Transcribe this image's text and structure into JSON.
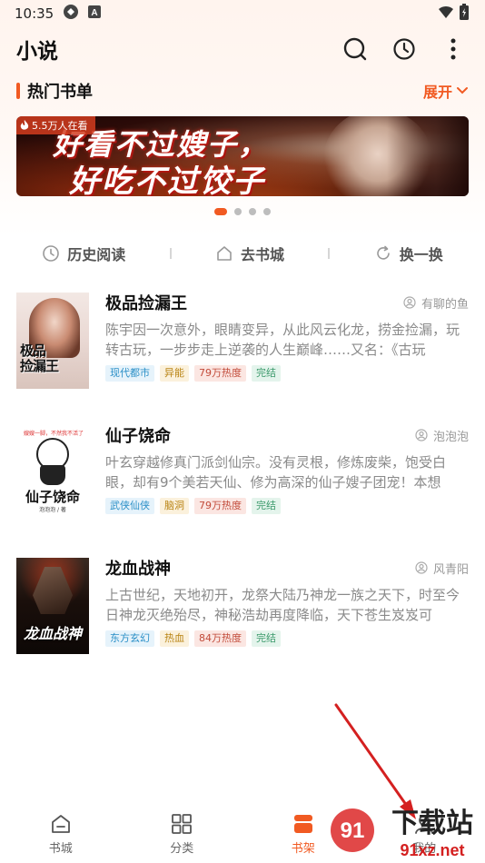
{
  "status_bar": {
    "time": "10:35"
  },
  "app_bar": {
    "title": "小说"
  },
  "section": {
    "title": "热门书单",
    "expand_label": "展开"
  },
  "banner": {
    "badge": "5.5万人在看",
    "line1": "好看不过嫂子，",
    "line2": "好吃不过饺子"
  },
  "carousel": {
    "pages": 4,
    "active": 0
  },
  "quick_actions": [
    {
      "label": "历史阅读",
      "icon": "clock-icon"
    },
    {
      "label": "去书城",
      "icon": "home-icon"
    },
    {
      "label": "换一换",
      "icon": "refresh-icon"
    }
  ],
  "books": [
    {
      "title": "极品捡漏王",
      "author": "有聊的鱼",
      "description": "陈宇因一次意外，眼睛变异，从此风云化龙，捞金捡漏，玩转古玩，一步步走上逆袭的人生巅峰……又名：《古玩",
      "tags": [
        "现代都市",
        "异能",
        "79万热度",
        "完结"
      ],
      "cover_text": "极品捡漏王"
    },
    {
      "title": "仙子饶命",
      "author": "泡泡泡",
      "description": "叶玄穿越修真门派剑仙宗。没有灵根，修炼废柴，饱受白眼，却有9个美若天仙、修为高深的仙子嫂子团宠！本想",
      "tags": [
        "武侠仙侠",
        "脑洞",
        "79万热度",
        "完结"
      ],
      "cover_text": "仙子饶命",
      "cover_sub": "嫂嫂一脚，不然我不活了",
      "cover_author": "泡泡泡 / 著"
    },
    {
      "title": "龙血战神",
      "author": "风青阳",
      "description": "上古世纪，天地初开，龙祭大陆乃神龙一族之天下，时至今日神龙灭绝殆尽，神秘浩劫再度降临，天下苍生岌岌可",
      "tags": [
        "东方玄幻",
        "热血",
        "84万热度",
        "完结"
      ],
      "cover_text": "龙血战神"
    }
  ],
  "bottom_nav": [
    {
      "label": "书城",
      "icon": "bookstore-icon"
    },
    {
      "label": "分类",
      "icon": "category-icon"
    },
    {
      "label": "书架",
      "icon": "bookshelf-icon",
      "active": true
    },
    {
      "label": "我的",
      "icon": "profile-icon"
    }
  ],
  "watermark": {
    "text": "下载站",
    "url_text": "91xz.net"
  },
  "colors": {
    "accent": "#f15a22",
    "arrow": "#d42020"
  }
}
